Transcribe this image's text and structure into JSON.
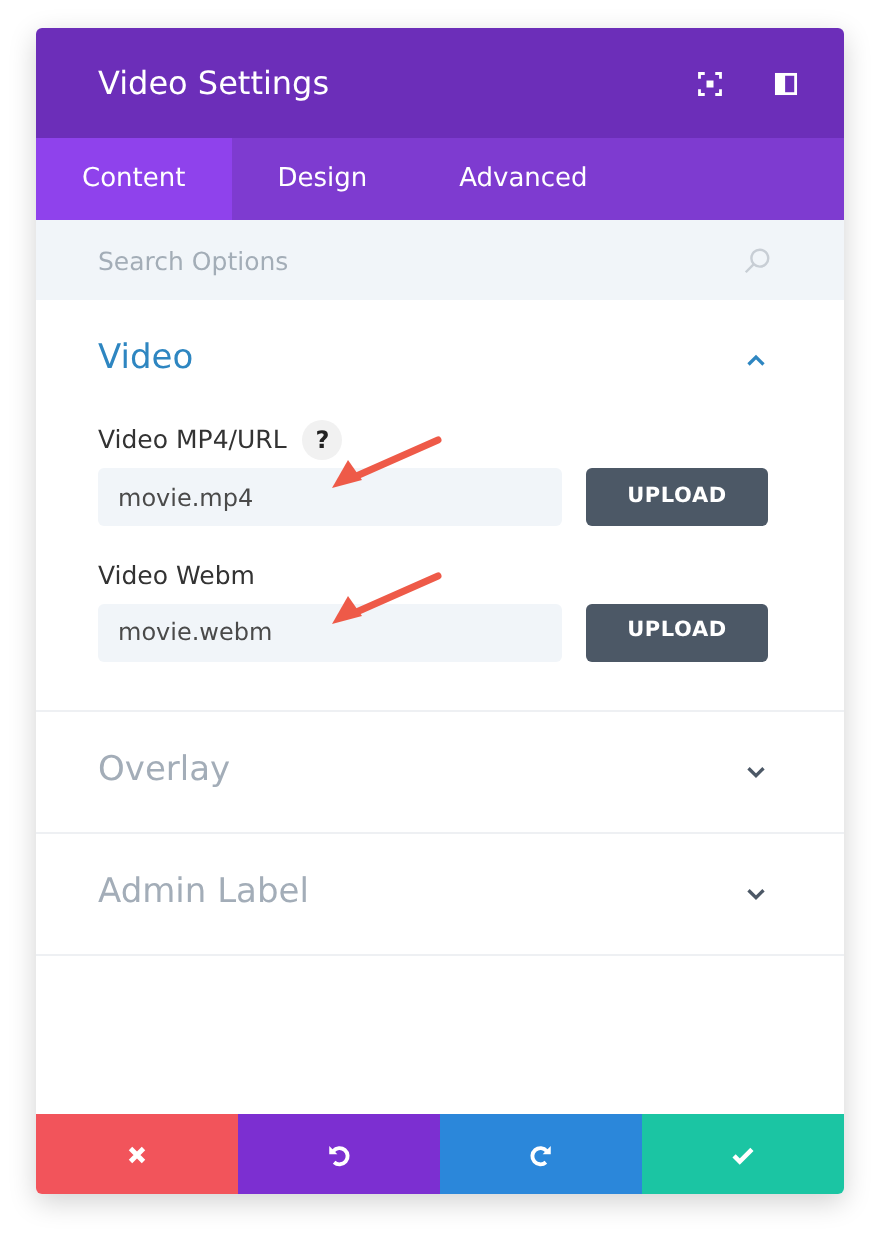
{
  "window": {
    "title": "Video Settings"
  },
  "header_icons": [
    {
      "kind": "expand"
    },
    {
      "kind": "sidebar"
    }
  ],
  "tabs": [
    {
      "label": "Content",
      "selected": true
    },
    {
      "label": "Design",
      "selected": false
    },
    {
      "label": "Advanced",
      "selected": false
    }
  ],
  "search": {
    "placeholder": "Search Options"
  },
  "sections": [
    {
      "title": "Video",
      "expanded": true,
      "fields": [
        {
          "label": "Video MP4/URL",
          "help": "?",
          "value": "movie.mp4",
          "button": "UPLOAD",
          "annotated": true
        },
        {
          "label": "Video Webm",
          "value": "movie.webm",
          "button": "UPLOAD",
          "annotated": true
        }
      ]
    },
    {
      "title": "Overlay",
      "expanded": false
    },
    {
      "title": "Admin Label",
      "expanded": false
    }
  ],
  "footer_buttons": [
    {
      "kind": "cancel"
    },
    {
      "kind": "undo"
    },
    {
      "kind": "redo"
    },
    {
      "kind": "save"
    }
  ]
}
